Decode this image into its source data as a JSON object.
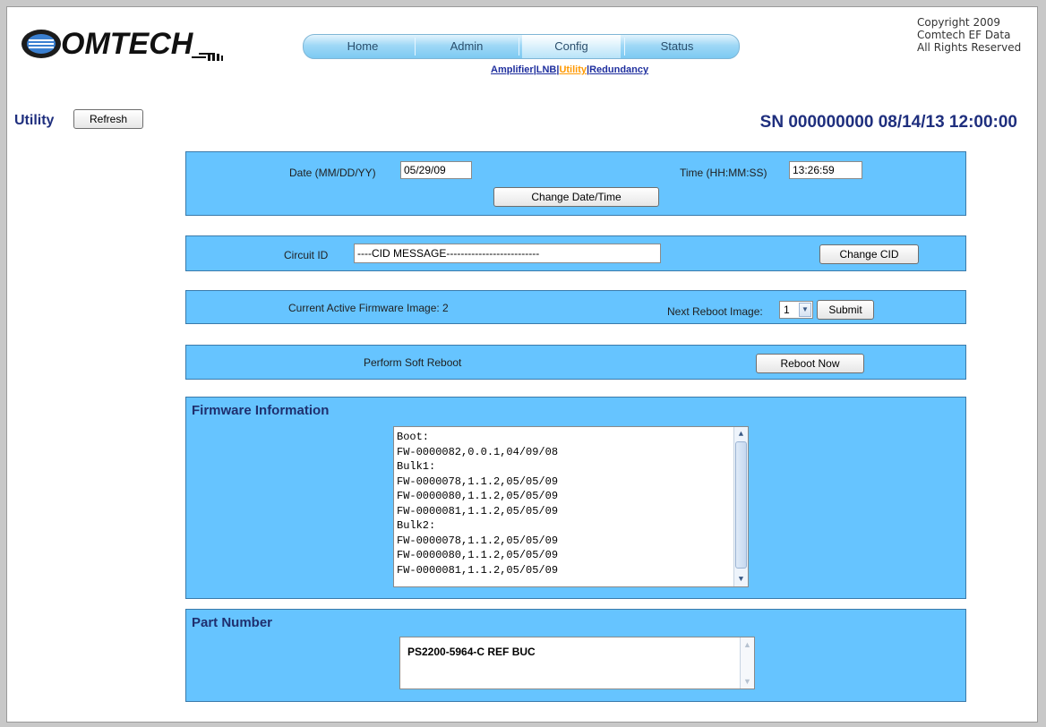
{
  "brand": {
    "logo_text": "OMTECH",
    "logo_initial": "C"
  },
  "nav": {
    "tabs": [
      {
        "label": "Home",
        "active": false
      },
      {
        "label": "Admin",
        "active": false
      },
      {
        "label": "Config",
        "active": true
      },
      {
        "label": "Status",
        "active": false
      }
    ]
  },
  "subnav": {
    "items": [
      {
        "label": "Amplifier",
        "current": false
      },
      {
        "label": "LNB",
        "current": false
      },
      {
        "label": "Utility",
        "current": true
      },
      {
        "label": "Redundancy",
        "current": false
      }
    ],
    "separator": "|"
  },
  "copyright": {
    "line1": "Copyright 2009",
    "line2": "Comtech EF Data",
    "line3": "All Rights Reserved"
  },
  "page": {
    "title": "Utility",
    "refresh_label": "Refresh",
    "sn_text": "SN 000000000 08/14/13 12:00:00"
  },
  "datetime": {
    "date_label": "Date (MM/DD/YY)",
    "date_value": "05/29/09",
    "time_label": "Time (HH:MM:SS)",
    "time_value": "13:26:59",
    "button_label": "Change Date/Time"
  },
  "circuit": {
    "label": "Circuit ID",
    "value": "----CID MESSAGE--------------------------",
    "button_label": "Change CID"
  },
  "firmware_image": {
    "current_label": "Current Active Firmware Image: 2",
    "next_label": "Next Reboot Image:",
    "next_value": "1",
    "submit_label": "Submit"
  },
  "reboot": {
    "label": "Perform Soft Reboot",
    "button_label": "Reboot Now"
  },
  "firmware_info": {
    "title": "Firmware Information",
    "lines": [
      "Boot:",
      "FW-0000082,0.0.1,04/09/08",
      "Bulk1:",
      "FW-0000078,1.1.2,05/05/09",
      "FW-0000080,1.1.2,05/05/09",
      "FW-0000081,1.1.2,05/05/09",
      "Bulk2:",
      "FW-0000078,1.1.2,05/05/09",
      "FW-0000080,1.1.2,05/05/09",
      "FW-0000081,1.1.2,05/05/09"
    ]
  },
  "part_number": {
    "title": "Part Number",
    "value": "PS2200-5964-C REF BUC"
  },
  "colors": {
    "panel": "#66c4ff",
    "heading": "#1f2f7e",
    "link": "#1f2f9e",
    "current_link": "#ff9900"
  }
}
